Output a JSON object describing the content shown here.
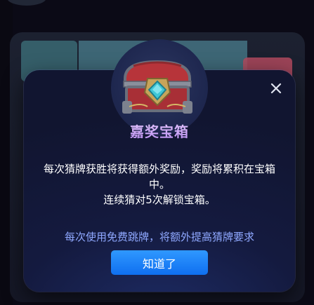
{
  "dialog": {
    "title": "嘉奖宝箱",
    "description_line1": "每次猜牌获胜将获得额外奖励，奖励将累积在宝箱中。",
    "description_line2": "连续猜对5次解锁宝箱。",
    "note": "每次使用免费跳牌，将额外提高猜牌要求",
    "confirm_label": "知道了",
    "close_icon": "close-icon",
    "chest_icon": "treasure-chest-icon"
  },
  "colors": {
    "dialog_bg": "#141a3f",
    "title_gradient_top": "#e8c9ff",
    "title_gradient_bottom": "#b98ef0",
    "note_text": "#8fa8ff",
    "button_blue": "#1a80f7",
    "chest_red": "#b7343a",
    "chest_gem": "#3fc7d6"
  }
}
